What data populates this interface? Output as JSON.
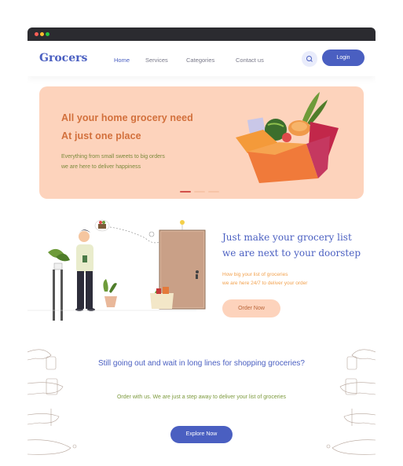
{
  "brand": {
    "name": "Grocers"
  },
  "nav": {
    "items": [
      {
        "label": "Home",
        "active": true
      },
      {
        "label": "Services",
        "active": false
      },
      {
        "label": "Categories",
        "active": false
      },
      {
        "label": "Contact us",
        "active": false
      }
    ],
    "search_icon": "search-icon",
    "login_label": "Login"
  },
  "hero": {
    "headline_line1": "All your home grocery need",
    "headline_line2": "At just one place",
    "subtext_line1": "Everything from small sweets to big orders",
    "subtext_line2": "we are here to deliver happiness",
    "slider_active_index": 0,
    "slider_count": 3
  },
  "delivery": {
    "title_line1": "Just make your grocery list",
    "title_line2": "we are next to your doorstep",
    "subtext_line1": "How big your list of groceries",
    "subtext_line2": "we are here 24/7 to deliver your order",
    "button_label": "Order Now"
  },
  "cta": {
    "title": "Still going out and wait in long lines for shopping groceries?",
    "subtext": "Order with us. We are just a step away to deliver your list of groceries",
    "button_label": "Explore Now"
  },
  "colors": {
    "primary": "#4a5fc1",
    "hero_bg": "#fdd3bc",
    "hero_text": "#d2703c",
    "accent_green": "#7c9a3d",
    "accent_orange": "#f2a24f",
    "window_dots": [
      "#ff5f57",
      "#febc2e",
      "#28c840"
    ]
  }
}
